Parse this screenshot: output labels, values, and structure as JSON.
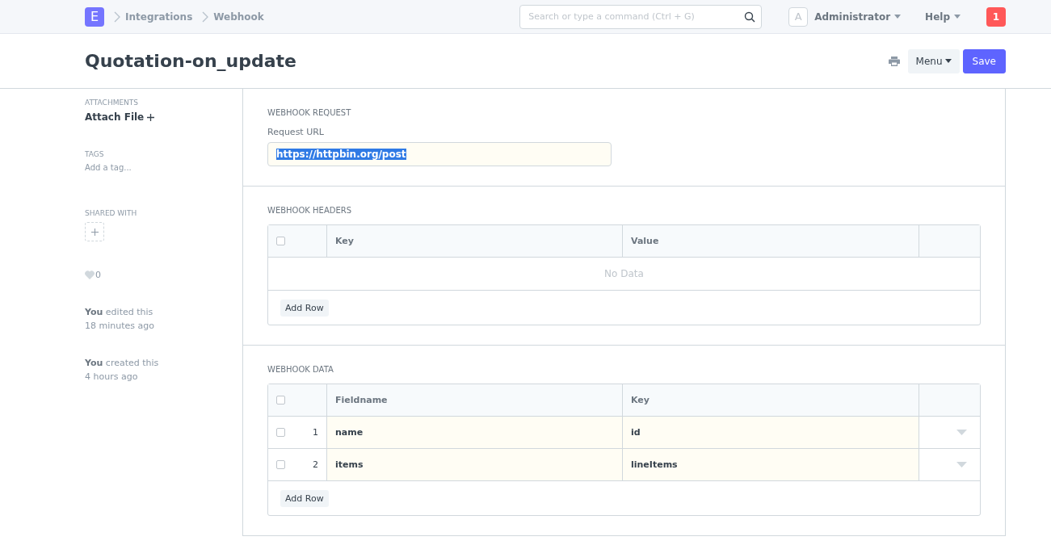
{
  "navbar": {
    "logo": "E",
    "breadcrumbs": [
      "Integrations",
      "Webhook"
    ],
    "search": {
      "placeholder": "Search or type a command (Ctrl + G)"
    },
    "avatar": "A",
    "user": "Administrator",
    "help": "Help",
    "notifications": "1"
  },
  "page": {
    "title": "Quotation-on_update",
    "menu": "Menu",
    "save": "Save"
  },
  "sidebar": {
    "attachments": {
      "heading": "ATTACHMENTS",
      "action": "Attach File"
    },
    "tags": {
      "heading": "TAGS",
      "placeholder": "Add a tag..."
    },
    "shared": {
      "heading": "SHARED WITH"
    },
    "likes": "0",
    "activity": [
      {
        "text": "**You** edited this",
        "time": "18 minutes ago"
      },
      {
        "text": "**You** created this",
        "time": "4 hours ago"
      }
    ]
  },
  "sections": [
    {
      "kind": "field",
      "heading": "WEBHOOK REQUEST",
      "label": "Request URL",
      "value": "https://httpbin.org/post",
      "text_selected": true
    },
    {
      "kind": "table",
      "heading": "WEBHOOK HEADERS",
      "select_all": {
        "checked": false
      },
      "columns": [
        "Key",
        "Value"
      ],
      "empty": "No Data",
      "add_row": "Add Row"
    },
    {
      "kind": "table",
      "heading": "WEBHOOK DATA",
      "select_all": {
        "checked": false
      },
      "columns": [
        "Fieldname",
        "Key"
      ],
      "rows": [
        {
          "index": "1",
          "cells": [
            "name",
            "id"
          ],
          "checked": false
        },
        {
          "index": "2",
          "cells": [
            "items",
            "lineItems"
          ],
          "checked": false
        }
      ],
      "add_row": "Add Row"
    }
  ]
}
